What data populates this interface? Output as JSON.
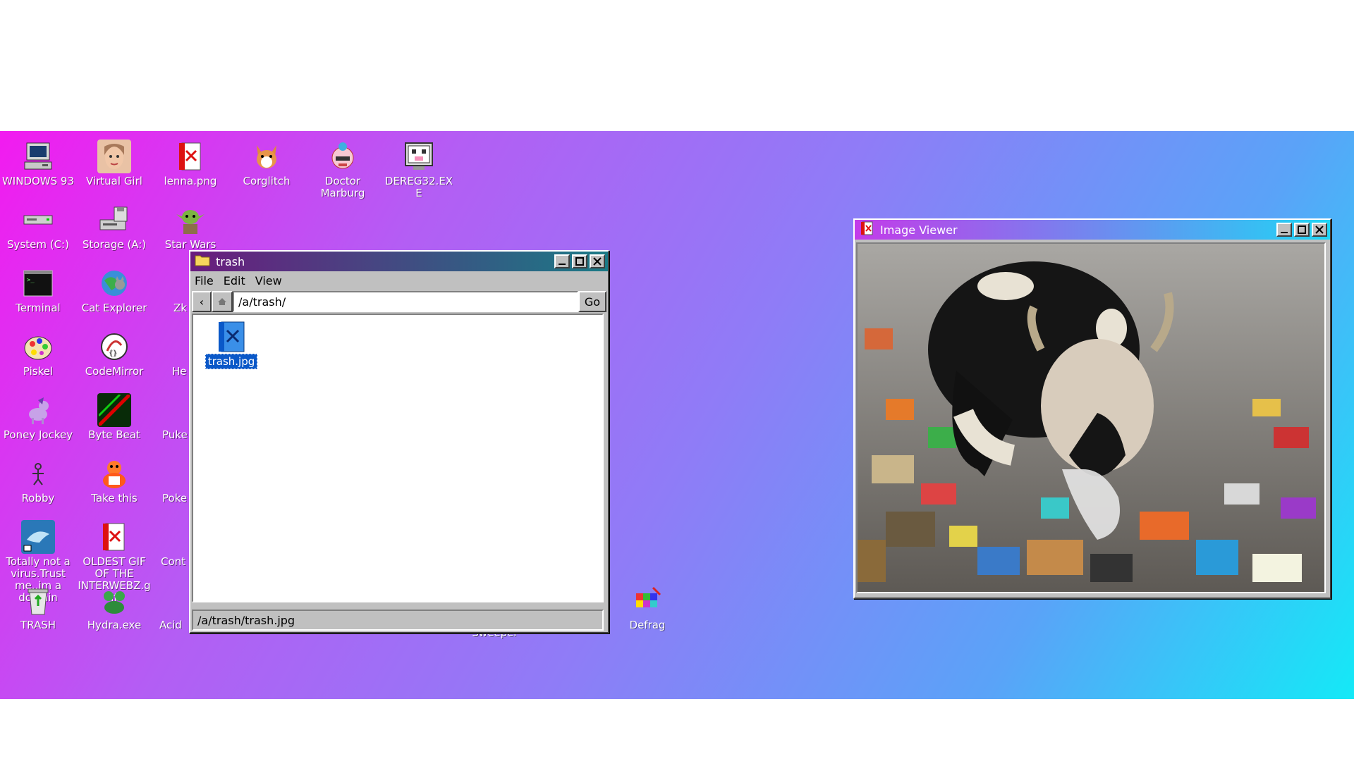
{
  "desktop": {
    "icons": [
      {
        "label": "WINDOWS 93",
        "icon": "computer-icon"
      },
      {
        "label": "Virtual Girl",
        "icon": "face-icon"
      },
      {
        "label": "lenna.png",
        "icon": "image-file-icon"
      },
      {
        "label": "Corglitch",
        "icon": "corgi-icon"
      },
      {
        "label": "Doctor Marburg",
        "icon": "doctor-icon"
      },
      {
        "label": "DEREG32.EXE",
        "icon": "monster-screen-icon"
      },
      {
        "label": "System (C:)",
        "icon": "drive-icon"
      },
      {
        "label": "Storage (A:)",
        "icon": "floppy-drive-icon"
      },
      {
        "label": "Star Wars",
        "icon": "yoda-icon"
      },
      {
        "label": "Terminal",
        "icon": "terminal-icon"
      },
      {
        "label": "Cat Explorer",
        "icon": "cat-globe-icon"
      },
      {
        "label": "Zk",
        "icon": "partial-icon"
      },
      {
        "label": "Piskel",
        "icon": "palette-icon"
      },
      {
        "label": "CodeMirror",
        "icon": "codemirror-icon"
      },
      {
        "label": "He",
        "icon": "partial-icon"
      },
      {
        "label": "Poney Jockey",
        "icon": "pony-icon"
      },
      {
        "label": "Byte Beat",
        "icon": "bytebeat-icon"
      },
      {
        "label": "Puke",
        "icon": "partial-icon"
      },
      {
        "label": "Robby",
        "icon": "stickman-icon"
      },
      {
        "label": "Take this",
        "icon": "duck-icon"
      },
      {
        "label": "Poke",
        "icon": "partial-icon"
      },
      {
        "label": "Totally not a virus.Trust me..im a dolphin",
        "icon": "dolphin-icon"
      },
      {
        "label": "OLDEST GIF OF THE INTERWEBZ.gif",
        "icon": "image-file-icon"
      },
      {
        "label": "Cont",
        "icon": "partial-icon"
      },
      {
        "label": "TRASH",
        "icon": "recycle-bin-icon"
      },
      {
        "label": "Hydra.exe",
        "icon": "hydra-icon"
      },
      {
        "label": "Acid",
        "icon": "partial-icon"
      },
      {
        "label": "Sweeper",
        "icon": "sweeper-icon"
      },
      {
        "label": "Defrag",
        "icon": "defrag-icon"
      }
    ]
  },
  "explorer": {
    "title": "trash",
    "menu": [
      "File",
      "Edit",
      "View"
    ],
    "path_value": "/a/trash/",
    "go_label": "Go",
    "back_glyph": "‹",
    "files": [
      {
        "name": "trash.jpg",
        "icon": "image-file-icon"
      }
    ],
    "status": "/a/trash/trash.jpg"
  },
  "viewer": {
    "title": "Image Viewer",
    "image_subject": "cow-in-trash-image"
  },
  "colors": {
    "explorer_titlebar_start": "#6a1c7e",
    "explorer_titlebar_end": "#1a7a86",
    "viewer_titlebar_start": "#c33be9",
    "viewer_titlebar_end": "#1fd5f5",
    "selection": "#0a58c8"
  }
}
